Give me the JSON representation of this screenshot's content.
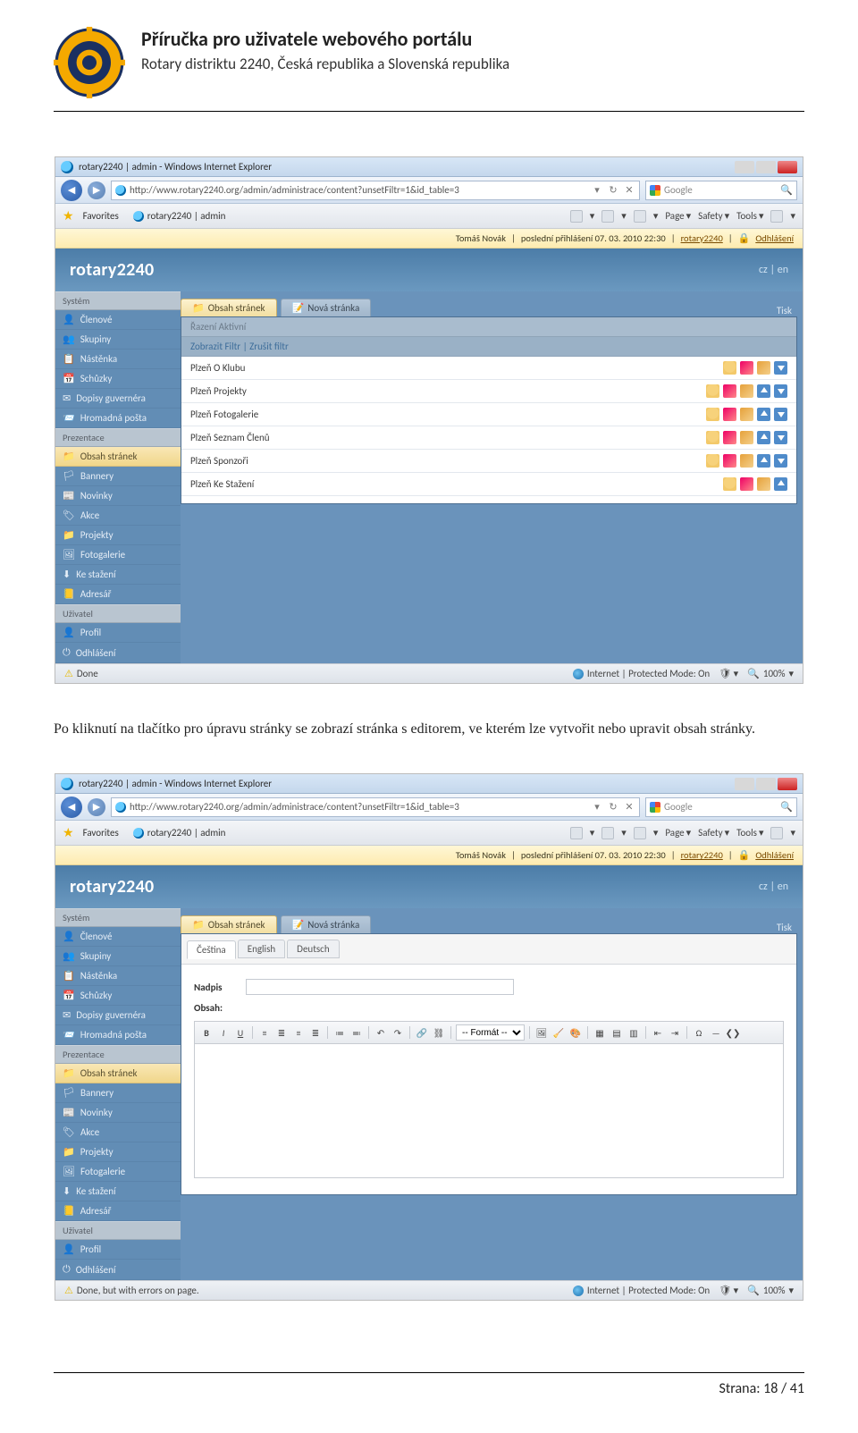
{
  "doc": {
    "title": "Příručka pro uživatele webového portálu",
    "subtitle": "Rotary distriktu 2240, Česká republika a Slovenská republika",
    "footer": "Strana: 18 / 41",
    "between_paragraph": "Po kliknutí na tlačítko pro úpravu stránky se zobrazí stránka s editorem, ve kterém lze vytvořit nebo upravit obsah stránky."
  },
  "browser": {
    "win_title": "rotary2240 | admin - Windows Internet Explorer",
    "url": "http://www.rotary2240.org/admin/administrace/content?unsetFiltr=1&id_table=3",
    "search_placeholder": "Google",
    "favorites_label": "Favorites",
    "tab_label": "rotary2240 | admin",
    "menus": [
      "Page",
      "Safety",
      "Tools"
    ],
    "status_done": "Done",
    "status_done_err": "Done, but with errors on page.",
    "status_zone": "Internet | Protected Mode: On",
    "zoom": "100%"
  },
  "app": {
    "title": "rotary2240",
    "notice_user": "Tomáš Novák",
    "notice_login": "poslední přihlášení 07. 03. 2010 22:30",
    "notice_link1": "rotary2240",
    "notice_logout": "Odhlášení",
    "head_lang": "cz | en",
    "sidebar": {
      "sec_system": "Systém",
      "items_system": [
        "Členové",
        "Skupiny",
        "Nástěnka",
        "Schůzky",
        "Dopisy guvernéra",
        "Hromadná pošta"
      ],
      "sec_prez": "Prezentace",
      "items_prez": [
        "Obsah stránek",
        "Bannery",
        "Novinky",
        "Akce",
        "Projekty",
        "Fotogalerie",
        "Ke stažení",
        "Adresář"
      ],
      "sec_user": "Uživatel",
      "items_user": [
        "Profil",
        "Odhlášení"
      ]
    },
    "tabs": {
      "content": "Obsah stránek",
      "new": "Nová stránka",
      "print": "Tisk"
    },
    "sort": {
      "razeni": "Řazení Aktivní",
      "filtr": "Zobrazit Filtr | Zrušit filtr"
    },
    "rows": [
      {
        "name": "Plzeň O Klubu",
        "actions": [
          "home",
          "del",
          "edit",
          "down"
        ]
      },
      {
        "name": "Plzeň Projekty",
        "actions": [
          "home",
          "del",
          "edit",
          "up",
          "down"
        ]
      },
      {
        "name": "Plzeň Fotogalerie",
        "actions": [
          "home",
          "del",
          "edit",
          "up",
          "down"
        ]
      },
      {
        "name": "Plzeň Seznam Členů",
        "actions": [
          "home",
          "del",
          "edit",
          "up",
          "down"
        ]
      },
      {
        "name": "Plzeň Sponzoři",
        "actions": [
          "home",
          "del",
          "edit",
          "up",
          "down"
        ]
      },
      {
        "name": "Plzeň Ke Stažení",
        "actions": [
          "home",
          "del",
          "edit",
          "up"
        ]
      }
    ],
    "editor": {
      "lang_tabs": [
        "Čeština",
        "English",
        "Deutsch"
      ],
      "label_nadpis": "Nadpis",
      "label_obsah": "Obsah:",
      "format_sel": "-- Formát --"
    }
  },
  "icons": {
    "folder": "📁",
    "note": "📝",
    "person": "👤",
    "group": "👥",
    "board": "📋",
    "meet": "📅",
    "mail": "✉",
    "bulk": "📨",
    "banner": "🏳",
    "news": "📰",
    "event": "🏷",
    "proj": "📁",
    "gallery": "🖼",
    "download": "⬇",
    "book": "📒",
    "profile": "👤",
    "logout": "⏻"
  }
}
